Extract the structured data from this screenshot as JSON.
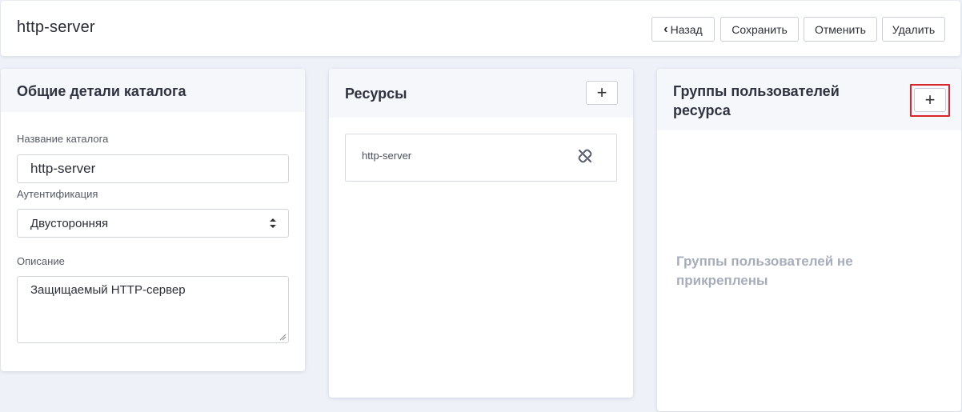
{
  "header": {
    "title": "http-server",
    "buttons": {
      "back": "Назад",
      "save": "Сохранить",
      "cancel": "Отменить",
      "delete": "Удалить"
    }
  },
  "catalog_details": {
    "title": "Общие детали каталога",
    "name_label": "Название каталога",
    "name_value": "http-server",
    "auth_label": "Аутентификация",
    "auth_value": "Двусторонняя",
    "description_label": "Описание",
    "description_value": "Защищаемый HTTP-сервер"
  },
  "resources": {
    "title": "Ресурсы",
    "add_label": "+",
    "items": [
      {
        "name": "http-server"
      }
    ]
  },
  "user_groups": {
    "title": "Группы пользователей ресурса",
    "add_label": "+",
    "empty_message": "Группы пользователей не прикреплены"
  },
  "colors": {
    "background": "#eef1f8",
    "card_header": "#f5f7fb",
    "highlight": "#d9262c",
    "muted_text": "#a7adbb"
  },
  "icons": {
    "back": "chevron-left-icon",
    "add": "plus-icon",
    "unlink": "unlink-icon",
    "select": "sort-arrows-icon"
  }
}
